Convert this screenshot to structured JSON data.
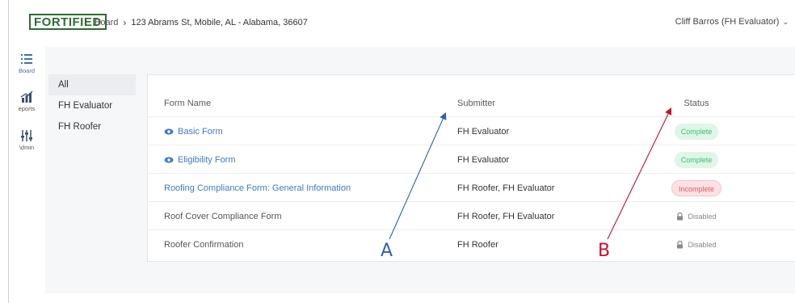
{
  "header": {
    "logo": "FORTIFIED",
    "breadcrumb_root": "Board",
    "breadcrumb_sep": "›",
    "breadcrumb_current": "123 Abrams St, Mobile, AL - Alabama, 36607",
    "user": "Cliff Barros (FH Evaluator)",
    "user_chevron": "⌄"
  },
  "rail": [
    {
      "label": "Board",
      "icon": "list-icon"
    },
    {
      "label": "eports",
      "icon": "chart-icon"
    },
    {
      "label": "\\dmin",
      "icon": "sliders-icon"
    }
  ],
  "subnav": [
    {
      "label": "All",
      "active": true
    },
    {
      "label": "FH Evaluator",
      "active": false
    },
    {
      "label": "FH Roofer",
      "active": false
    }
  ],
  "table": {
    "headers": {
      "name": "Form Name",
      "submitter": "Submitter",
      "status": "Status"
    },
    "rows": [
      {
        "name": "Basic Form",
        "submitter": "FH Evaluator",
        "status": "Complete"
      },
      {
        "name": "Eligibility Form",
        "submitter": "FH Evaluator",
        "status": "Complete"
      },
      {
        "name": "Roofing Compliance Form: General Information",
        "submitter": "FH Roofer, FH Evaluator",
        "status": "Incomplete"
      },
      {
        "name": "Roof Cover Compliance Form",
        "submitter": "FH Roofer, FH Evaluator",
        "status": "Disabled"
      },
      {
        "name": "Roofer Confirmation",
        "submitter": "FH Roofer",
        "status": "Disabled"
      }
    ]
  },
  "annotations": {
    "a": "A",
    "b": "B",
    "a_color": "#2f5fb8",
    "b_color": "#c8102e"
  },
  "colors": {
    "brand_green": "#2e6b2e",
    "link_blue": "#3e7ac9",
    "complete_bg": "#dff5e8",
    "complete_text": "#3fbf75",
    "incomplete_bg": "#fbe1e3",
    "incomplete_text": "#e45a68"
  }
}
